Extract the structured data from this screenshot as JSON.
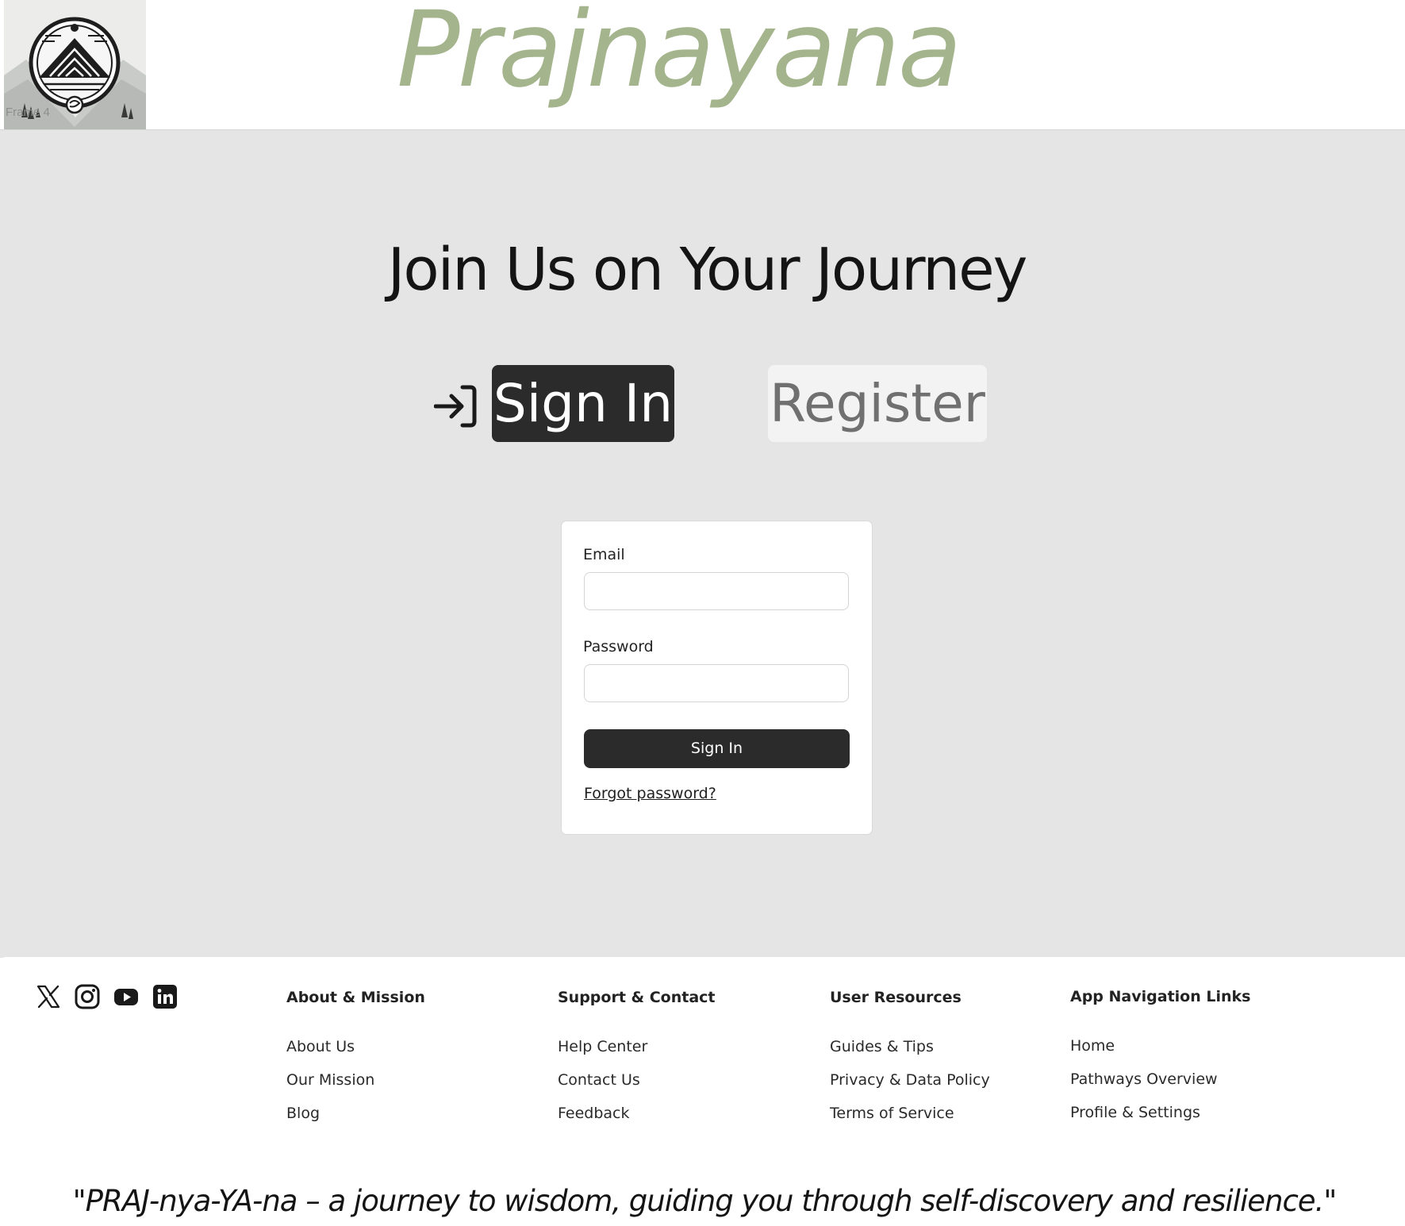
{
  "header": {
    "logo_label": "Frame 4",
    "brand": "Prajnayana"
  },
  "main": {
    "title": "Join Us on Your Journey",
    "tabs": {
      "signin_icon": "sign-in-arrow-icon",
      "signin_label": "Sign In",
      "register_label": "Register"
    },
    "form": {
      "email_label": "Email",
      "email_value": "",
      "password_label": "Password",
      "password_value": "",
      "submit_label": "Sign In",
      "forgot_label": "Forgot password?"
    }
  },
  "footer": {
    "social_icons": [
      "x-icon",
      "instagram-icon",
      "youtube-icon",
      "linkedin-icon"
    ],
    "columns": [
      {
        "heading": "About & Mission",
        "links": [
          "About Us",
          "Our Mission",
          "Blog"
        ]
      },
      {
        "heading": "Support & Contact",
        "links": [
          "Help Center",
          "Contact Us",
          "Feedback"
        ]
      },
      {
        "heading": "User Resources",
        "links": [
          "Guides & Tips",
          "Privacy & Data Policy",
          "Terms of Service"
        ]
      },
      {
        "heading": "App Navigation Links",
        "links": [
          "Home",
          "Pathways Overview",
          "Profile & Settings"
        ]
      }
    ],
    "tagline": "\"PRAJ-nya-YA-na – a journey to wisdom, guiding you through self-discovery and resilience.\""
  },
  "colors": {
    "brand": "#a4b48c",
    "dark_button": "#2b2b2b",
    "main_background": "#e5e5e5"
  }
}
